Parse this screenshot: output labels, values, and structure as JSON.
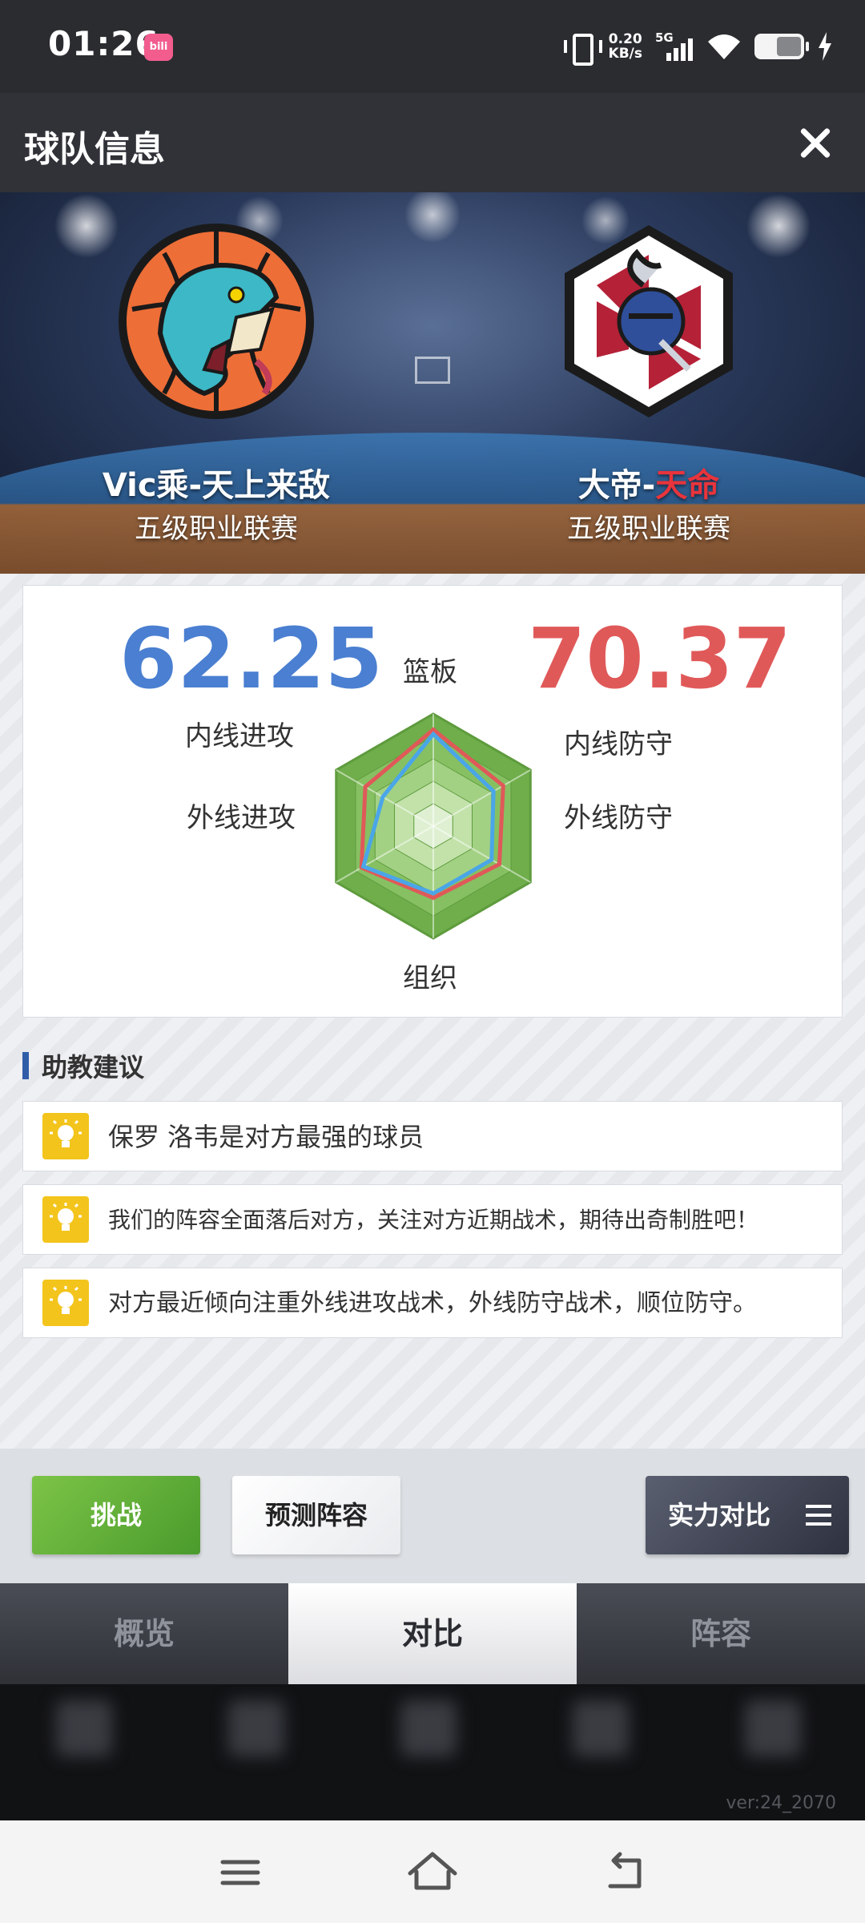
{
  "status_bar": {
    "time": "01:26",
    "app_badge": "bilibili",
    "net_speed_value": "0.20",
    "net_speed_unit": "KB/s",
    "network": "5G",
    "icons": [
      "vibrate-icon",
      "signal-icon",
      "wifi-icon",
      "battery-icon",
      "charging-bolt-icon"
    ]
  },
  "header": {
    "title": "球队信息",
    "close_icon": "close-icon"
  },
  "teams": {
    "home": {
      "name": "Vic乘-天上来敌",
      "league": "五级职业联赛",
      "score": "62.25",
      "color": "#4a7fd1"
    },
    "away": {
      "name_prefix": "大帝-",
      "name_highlight": "天命",
      "league": "五级职业联赛",
      "score": "70.37",
      "color": "#e05959"
    }
  },
  "radar": {
    "axes": [
      "篮板",
      "内线防守",
      "外线防守",
      "组织",
      "外线进攻",
      "内线进攻"
    ],
    "home_values": [
      0.82,
      0.62,
      0.6,
      0.6,
      0.72,
      0.52
    ],
    "away_values": [
      0.86,
      0.72,
      0.68,
      0.64,
      0.74,
      0.7
    ]
  },
  "advice": {
    "heading": "助教建议",
    "items": [
      {
        "text": "保罗 洛韦是对方最强的球员"
      },
      {
        "text": "我们的阵容全面落后对方，关注对方近期战术，期待出奇制胜吧！"
      },
      {
        "text": "对方最近倾向注重外线进攻战术，外线防守战术，顺位防守。"
      }
    ],
    "icon": "lightbulb-icon"
  },
  "actions": {
    "challenge": "挑战",
    "predict_lineup": "预测阵容",
    "strength_compare": "实力对比"
  },
  "tabs": [
    {
      "label": "概览",
      "active": false
    },
    {
      "label": "对比",
      "active": true
    },
    {
      "label": "阵容",
      "active": false
    }
  ],
  "footer": {
    "version": "ver:24_2070"
  },
  "nav_bar": {
    "icons": [
      "menu-icon",
      "home-icon",
      "back-icon"
    ]
  }
}
